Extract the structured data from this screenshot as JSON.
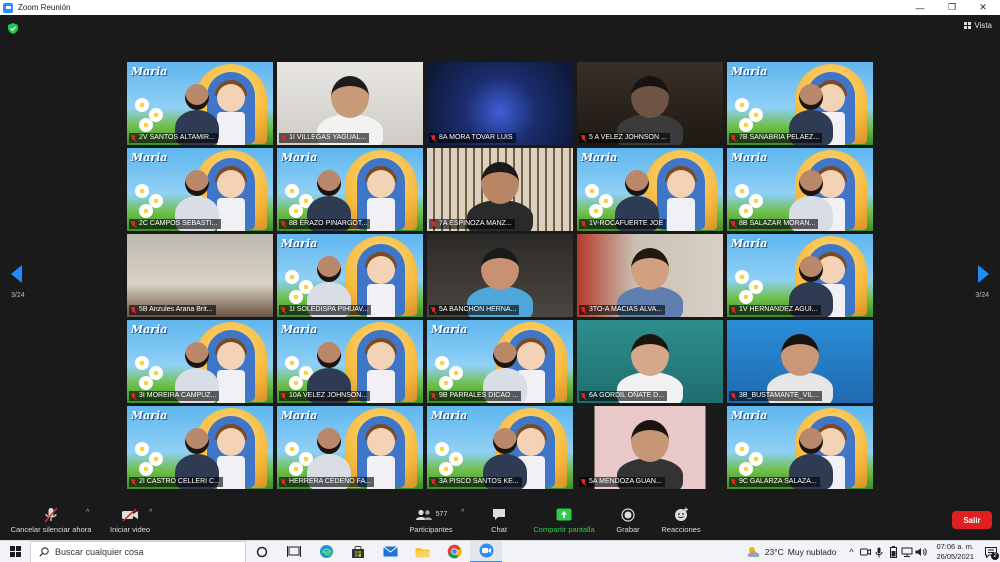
{
  "window": {
    "title": "Zoom Reunión",
    "minimize_glyph": "—",
    "maximize_glyph": "❐",
    "close_glyph": "✕"
  },
  "meeting": {
    "view_label": "Vista",
    "page_left": "3/24",
    "page_right": "3/24",
    "background_caption": "Maria",
    "participants": [
      {
        "name": "2V SANTOS ALTAMIR...",
        "bg": "maria"
      },
      {
        "name": "1I VILLEGAS YAGUAL...",
        "bg": "room-white"
      },
      {
        "name": "8A MORA TOVAR LUIS",
        "bg": "dark-blue-light"
      },
      {
        "name": "5 A VELEZ JOHNSON ...",
        "bg": "dark-close"
      },
      {
        "name": "7B SANABRIA PELAEZ...",
        "bg": "maria"
      },
      {
        "name": "2C CAMPOS SEBASTI...",
        "bg": "maria"
      },
      {
        "name": "8B ERAZO PINARGOT...",
        "bg": "maria"
      },
      {
        "name": "7A ESPINOZA MANZ...",
        "bg": "window-bars"
      },
      {
        "name": "1V-ROCAFUERTE JOE",
        "bg": "maria"
      },
      {
        "name": "8B SALAZAR MORAN...",
        "bg": "maria"
      },
      {
        "name": "5B Anzules Arana Brit...",
        "bg": "ceiling"
      },
      {
        "name": "1I SOLEDISPA PIHUAV...",
        "bg": "maria"
      },
      {
        "name": "5A BANCHON HERNA...",
        "bg": "shelf"
      },
      {
        "name": "3TO-A MACIAS ALVA...",
        "bg": "room-red"
      },
      {
        "name": "1V HERNANDEZ AGUI...",
        "bg": "maria"
      },
      {
        "name": "3I MOREIRA CAMPUZ...",
        "bg": "maria"
      },
      {
        "name": "10A VELEZ JOHNSON...",
        "bg": "maria"
      },
      {
        "name": "9B PARRALES DICAO ...",
        "bg": "maria"
      },
      {
        "name": "6A GORDIL OÑATE D...",
        "bg": "teal-room"
      },
      {
        "name": "3B_BUSTAMANTE_VIL...",
        "bg": "blue-room"
      },
      {
        "name": "2I CASTRO CELLERI C...",
        "bg": "maria"
      },
      {
        "name": "HERRERA CEDEÑO FA...",
        "bg": "maria"
      },
      {
        "name": "3A PISCO SANTOS KE...",
        "bg": "maria"
      },
      {
        "name": "5A MENDOZA GUAN...",
        "bg": "pink-room"
      },
      {
        "name": "9C GALARZA SALAZA...",
        "bg": "maria"
      }
    ]
  },
  "toolbar": {
    "unmute_label": "Cancelar silenciar ahora",
    "video_label": "Iniciar video",
    "participants_label": "Participantes",
    "participants_count": "577",
    "chat_label": "Chat",
    "share_label": "Compartir pantalla",
    "record_label": "Grabar",
    "reactions_label": "Reacciones",
    "leave_label": "Salir",
    "caret": "^"
  },
  "taskbar": {
    "search_placeholder": "Buscar cualquier cosa",
    "temperature": "23°C",
    "weather": "Muy nublado",
    "time": "07:06 a. m.",
    "date": "26/05/2021",
    "notif_count": "2",
    "caret": "^"
  },
  "colors": {
    "meeting_bg": "#1a1a1a",
    "zoom_blue": "#2d8cff",
    "share_green": "#2ecc4a",
    "leave_red": "#e02020",
    "mute_red": "#e02828"
  }
}
